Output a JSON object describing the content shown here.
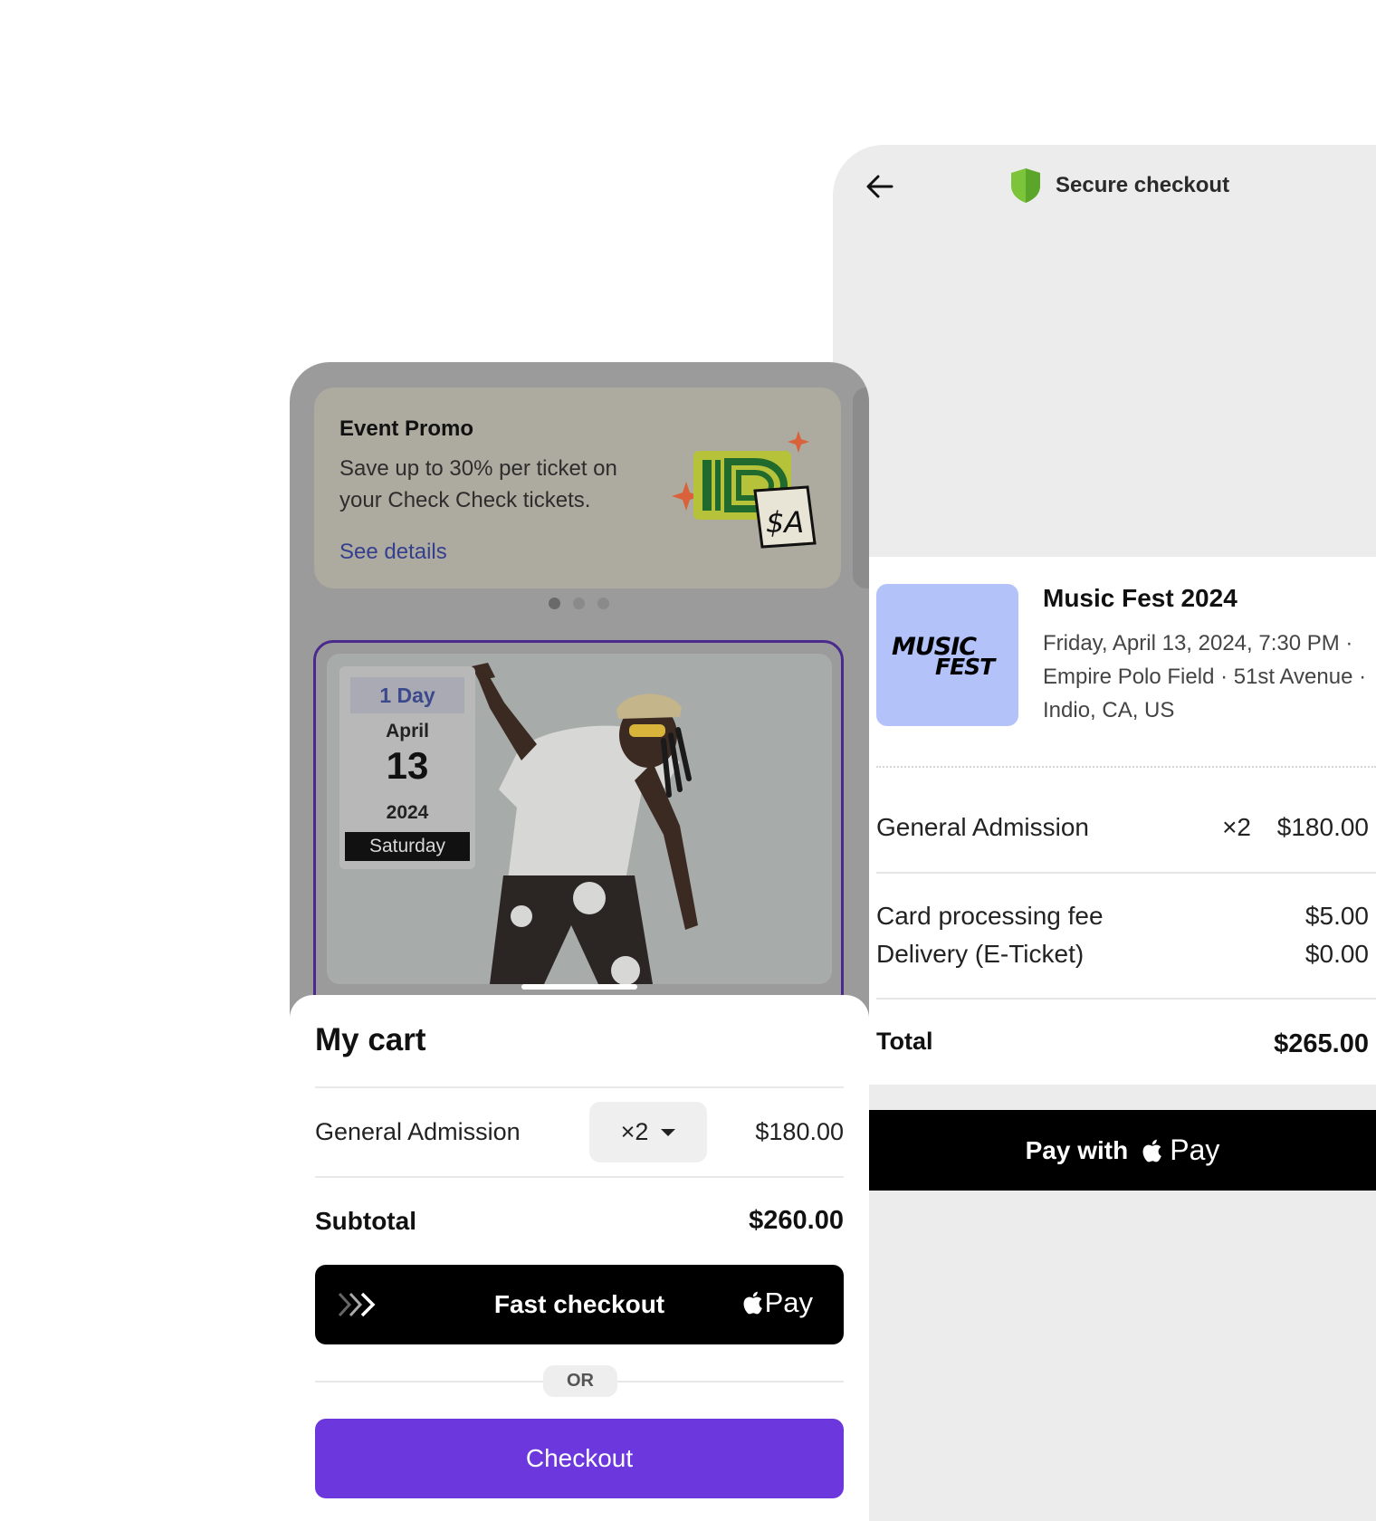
{
  "secure_checkout": {
    "title": "Secure checkout",
    "event": {
      "name": "Music Fest 2024",
      "details": "Friday, April 13, 2024, 7:30 PM · Empire Polo Field · 51st Avenue · Indio, CA, US",
      "logo_line1": "MUSIC",
      "logo_line2": "FEST"
    },
    "line_items": [
      {
        "label": "General Admission",
        "qty": "×2",
        "amount": "$180.00"
      },
      {
        "label": "Card processing fee",
        "qty": "",
        "amount": "$5.00"
      },
      {
        "label": "Delivery (E-Ticket)",
        "qty": "",
        "amount": "$0.00"
      }
    ],
    "total_label": "Total",
    "total_amount": "$265.00",
    "pay_button": {
      "prefix": "Pay with",
      "brand": "Pay"
    }
  },
  "phone": {
    "promo": {
      "title": "Event Promo",
      "text": "Save up to 30% per ticket on your Check Check tickets.",
      "link": "See details",
      "carousel_active_index": 0,
      "carousel_count": 3
    },
    "event_date": {
      "days": "1 Day",
      "month": "April",
      "day": "13",
      "year": "2024",
      "weekday": "Saturday"
    }
  },
  "cart": {
    "title": "My cart",
    "item": {
      "label": "General Admission",
      "qty": "×2",
      "price": "$180.00"
    },
    "subtotal_label": "Subtotal",
    "subtotal_amount": "$260.00",
    "fast_checkout": {
      "label": "Fast checkout",
      "brand": "Pay"
    },
    "or_label": "OR",
    "checkout_label": "Checkout"
  },
  "colors": {
    "accent": "#6c37dc",
    "panel_bg": "#ececec",
    "shield": "#7cc43a",
    "link": "#353f8f",
    "event_thumb_bg": "#b3c3fa"
  }
}
